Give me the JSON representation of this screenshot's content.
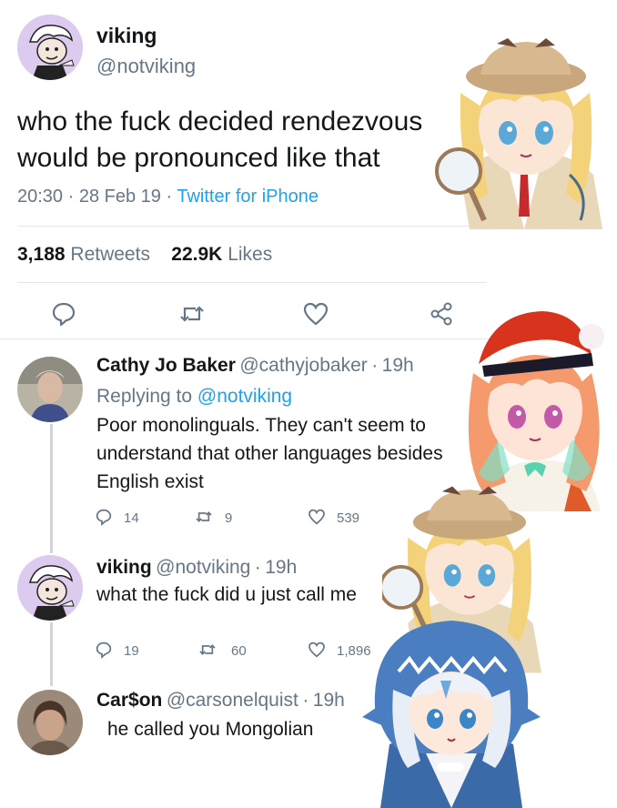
{
  "main_tweet": {
    "name": "viking",
    "handle": "@notviking",
    "text_line1": "who the fuck decided rendezvous",
    "text_line2": "would be pronounced like that",
    "time": "20:30",
    "date": "28 Feb 19",
    "source": "Twitter for iPhone",
    "retweets_count": "3,188",
    "retweets_label": "Retweets",
    "likes_count": "22.9K",
    "likes_label": "Likes"
  },
  "replies": [
    {
      "name": "Cathy Jo Baker",
      "handle": "@cathyjobaker",
      "time": "19h",
      "replying_prefix": "Replying to",
      "replying_to": "@notviking",
      "line1": "Poor monolinguals. They can't seem to",
      "line2": "understand that other languages besides",
      "line3": "English exist",
      "replies": "14",
      "retweets": "9",
      "likes": "539"
    },
    {
      "name": "viking",
      "handle": "@notviking",
      "time": "19h",
      "line1": "what the fuck did u just call me",
      "replies": "19",
      "retweets": "60",
      "likes": "1,896"
    },
    {
      "name": "Car$on",
      "handle": "@carsonelquist",
      "time": "19h",
      "line1": "he called you Mongolian"
    }
  ],
  "separator": "·",
  "icons": {
    "reply": "reply-icon",
    "retweet": "retweet-icon",
    "like": "heart-icon",
    "share": "share-icon"
  },
  "colors": {
    "link": "#1da1f2",
    "muted": "#657786",
    "text": "#14171a",
    "divider": "#e1e8ed"
  }
}
